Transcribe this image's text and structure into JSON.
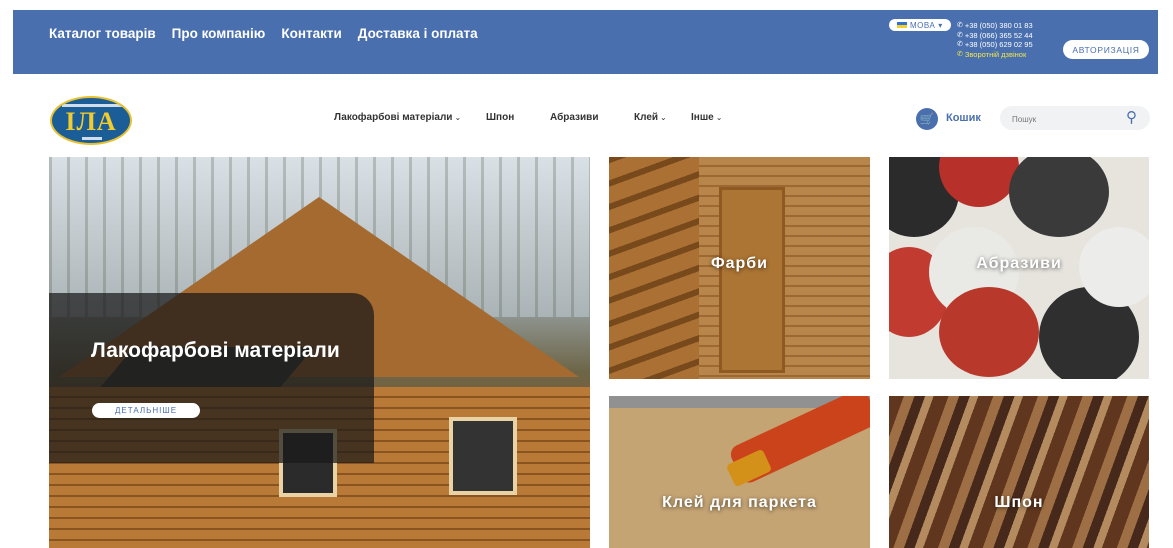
{
  "topbar": {
    "nav": [
      "Каталог товарів",
      "Про компанію",
      "Контакти",
      "Доставка і оплата"
    ],
    "language": "МОВА",
    "phones": [
      "+38 (050) 380 01 83",
      "+38 (066) 365 52 44",
      "+38 (050) 629 02 95"
    ],
    "callback": "Зворотній дзвінок",
    "auth": "АВТОРИЗАЦІЯ",
    "colors": {
      "bar": "#4a6fae",
      "callback": "#f2e84a"
    }
  },
  "header": {
    "logo_text": "ІЛА",
    "menu": [
      {
        "label": "Лакофарбові матеріали",
        "dropdown": true
      },
      {
        "label": "Шпон",
        "dropdown": false
      },
      {
        "label": "Абразиви",
        "dropdown": false
      },
      {
        "label": "Клей",
        "dropdown": true
      },
      {
        "label": "Інше",
        "dropdown": true
      }
    ],
    "cart": "Кошик",
    "search_placeholder": "Пошук"
  },
  "tiles": {
    "hero_title": "Лакофарбові матеріали",
    "hero_button": "ДЕТАЛЬНІШЕ",
    "paint": "Фарби",
    "abrasives": "Абразиви",
    "glue": "Клей для паркета",
    "veneer": "Шпон"
  },
  "icons": {
    "cart": "cart-icon",
    "search": "search-icon",
    "phone": "phone-icon",
    "chevron": "chevron-down-icon"
  }
}
